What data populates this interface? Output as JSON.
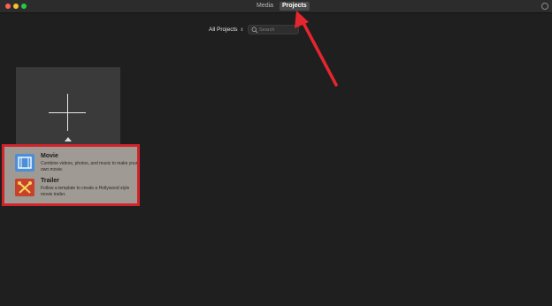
{
  "titlebar": {
    "tabs": [
      {
        "label": "Media",
        "active": false
      },
      {
        "label": "Projects",
        "active": true
      }
    ]
  },
  "toolbar": {
    "filter_label": "All Projects",
    "filter_chevron": "⇕",
    "search_placeholder": "Search"
  },
  "popover": {
    "options": [
      {
        "title": "Movie",
        "description": "Combine videos, photos, and music to make your own movie.",
        "icon": "film-icon"
      },
      {
        "title": "Trailer",
        "description": "Follow a template to create a Hollywood style movie trailer.",
        "icon": "trailer-icon"
      }
    ]
  },
  "colors": {
    "highlight": "#d3232b",
    "annotation_arrow": "#e5262e"
  }
}
